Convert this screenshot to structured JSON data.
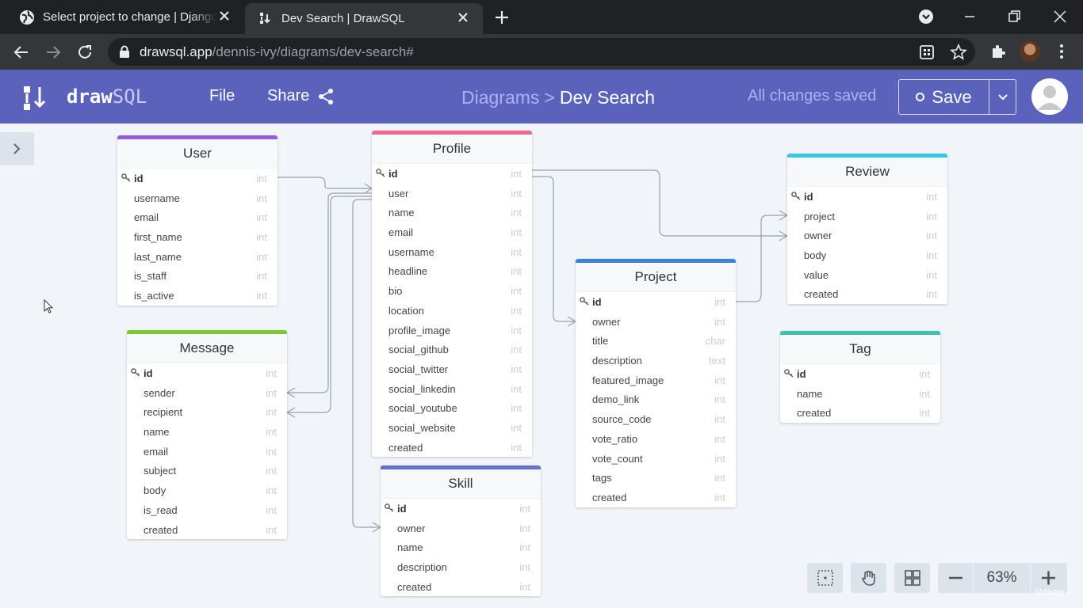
{
  "browser": {
    "tabs": [
      {
        "title": "Select project to change | Django",
        "active": false
      },
      {
        "title": "Dev Search | DrawSQL",
        "active": true
      }
    ],
    "url_host": "drawsql.app",
    "url_path": "/dennis-ivy/diagrams/dev-search#"
  },
  "app": {
    "logo_bold": "draw",
    "logo_light": "SQL",
    "menu": {
      "file": "File",
      "share": "Share"
    },
    "breadcrumb": {
      "parent": "Diagrams",
      "separator": ">",
      "current": "Dev Search"
    },
    "save_status": "All changes saved",
    "save_label": "Save"
  },
  "tables": [
    {
      "name": "User",
      "color": "#9a5cd6",
      "fields": [
        {
          "name": "id",
          "type": "int",
          "pk": true
        },
        {
          "name": "username",
          "type": "int"
        },
        {
          "name": "email",
          "type": "int"
        },
        {
          "name": "first_name",
          "type": "int"
        },
        {
          "name": "last_name",
          "type": "int"
        },
        {
          "name": "is_staff",
          "type": "int"
        },
        {
          "name": "is_active",
          "type": "int"
        }
      ]
    },
    {
      "name": "Profile",
      "color": "#ec6a8c",
      "fields": [
        {
          "name": "id",
          "type": "int",
          "pk": true
        },
        {
          "name": "user",
          "type": "int"
        },
        {
          "name": "name",
          "type": "int"
        },
        {
          "name": "email",
          "type": "int"
        },
        {
          "name": "username",
          "type": "int"
        },
        {
          "name": "headline",
          "type": "int"
        },
        {
          "name": "bio",
          "type": "int"
        },
        {
          "name": "location",
          "type": "int"
        },
        {
          "name": "profile_image",
          "type": "int"
        },
        {
          "name": "social_github",
          "type": "int"
        },
        {
          "name": "social_twitter",
          "type": "int"
        },
        {
          "name": "social_linkedin",
          "type": "int"
        },
        {
          "name": "social_youtube",
          "type": "int"
        },
        {
          "name": "social_website",
          "type": "int"
        },
        {
          "name": "created",
          "type": "int"
        }
      ]
    },
    {
      "name": "Review",
      "color": "#30c8e2",
      "fields": [
        {
          "name": "id",
          "type": "int",
          "pk": true
        },
        {
          "name": "project",
          "type": "int"
        },
        {
          "name": "owner",
          "type": "int"
        },
        {
          "name": "body",
          "type": "int"
        },
        {
          "name": "value",
          "type": "int"
        },
        {
          "name": "created",
          "type": "int"
        }
      ]
    },
    {
      "name": "Project",
      "color": "#3d82d6",
      "fields": [
        {
          "name": "id",
          "type": "int",
          "pk": true
        },
        {
          "name": "owner",
          "type": "int"
        },
        {
          "name": "title",
          "type": "char"
        },
        {
          "name": "description",
          "type": "text"
        },
        {
          "name": "featured_image",
          "type": "int"
        },
        {
          "name": "demo_link",
          "type": "int"
        },
        {
          "name": "source_code",
          "type": "int"
        },
        {
          "name": "vote_ratio",
          "type": "int"
        },
        {
          "name": "vote_count",
          "type": "int"
        },
        {
          "name": "tags",
          "type": "int"
        },
        {
          "name": "created",
          "type": "int"
        }
      ]
    },
    {
      "name": "Message",
      "color": "#7cc832",
      "fields": [
        {
          "name": "id",
          "type": "int",
          "pk": true
        },
        {
          "name": "sender",
          "type": "int"
        },
        {
          "name": "recipient",
          "type": "int"
        },
        {
          "name": "name",
          "type": "int"
        },
        {
          "name": "email",
          "type": "int"
        },
        {
          "name": "subject",
          "type": "int"
        },
        {
          "name": "body",
          "type": "int"
        },
        {
          "name": "is_read",
          "type": "int"
        },
        {
          "name": "created",
          "type": "int"
        }
      ]
    },
    {
      "name": "Tag",
      "color": "#3ec2b4",
      "fields": [
        {
          "name": "id",
          "type": "int",
          "pk": true
        },
        {
          "name": "name",
          "type": "int"
        },
        {
          "name": "created",
          "type": "int"
        }
      ]
    },
    {
      "name": "Skill",
      "color": "#6670c8",
      "fields": [
        {
          "name": "id",
          "type": "int",
          "pk": true
        },
        {
          "name": "owner",
          "type": "int"
        },
        {
          "name": "name",
          "type": "int"
        },
        {
          "name": "description",
          "type": "int"
        },
        {
          "name": "created",
          "type": "int"
        }
      ]
    }
  ],
  "toolbar": {
    "zoom_level": "63%",
    "tools": [
      "fit-screen-icon",
      "hand-icon",
      "grid-icon"
    ]
  },
  "watermark": "Udemy"
}
